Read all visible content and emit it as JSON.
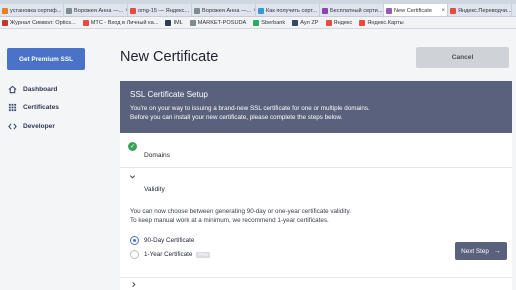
{
  "browser": {
    "tabs": [
      {
        "label": "установка сертиф...",
        "color": "#e67e22"
      },
      {
        "label": "Ворожея Анна —...",
        "color": "#7f8c8d"
      },
      {
        "label": "omg-15 — Яндекс...",
        "color": "#e74c3c"
      },
      {
        "label": "Ворожея Анна —...",
        "color": "#7f8c8d"
      },
      {
        "label": "Как получить серт...",
        "color": "#3498db"
      },
      {
        "label": "Бесплатный серти...",
        "color": "#8e44ad"
      },
      {
        "label": "New Certificate",
        "color": "#9b59b6",
        "active": true
      },
      {
        "label": "Яндекс.Переводчи...",
        "color": "#e74c3c"
      }
    ],
    "bookmarks": [
      {
        "label": "Журнал Символ: Optics...",
        "color": "#c0392b"
      },
      {
        "label": "МТС - Вход в Личный ка...",
        "color": "#e74c3c"
      },
      {
        "label": "IML",
        "color": "#2c3e50"
      },
      {
        "label": "MARKET-POSUDA",
        "color": "#7f8c8d"
      },
      {
        "label": "Sberbank",
        "color": "#27ae60"
      },
      {
        "label": "Аул ZP",
        "color": "#34495e"
      },
      {
        "label": "Яндекс",
        "color": "#e74c3c"
      },
      {
        "label": "Яндекс.Карты",
        "color": "#e74c3c"
      }
    ]
  },
  "sidebar": {
    "premium_button": "Get Premium SSL",
    "items": [
      {
        "label": "Dashboard",
        "icon": "home-icon"
      },
      {
        "label": "Certificates",
        "icon": "grid-icon"
      },
      {
        "label": "Developer",
        "icon": "code-icon"
      }
    ]
  },
  "header": {
    "title": "New Certificate",
    "cancel_label": "Cancel"
  },
  "setup": {
    "title": "SSL Certificate Setup",
    "subtitle_line1": "You're on your way to issuing a brand-new SSL certificate for one or multiple domains.",
    "subtitle_line2": "Before you can install your new certificate, please complete the steps below."
  },
  "steps": {
    "domains_label": "Domains",
    "validity_label": "Validity",
    "validity_desc1": "You can now choose between generating 90-day or one-year certificate validity.",
    "validity_desc2": "To keep manual work at a minimum, we recommend 1-year certificates.",
    "options": [
      {
        "label": "90-Day Certificate",
        "selected": true
      },
      {
        "label": "1-Year Certificate",
        "selected": false,
        "badge": "PRO"
      }
    ],
    "next_label": "Next Step"
  },
  "colors": {
    "accent": "#4a72c9",
    "header_bg": "#59617c",
    "success": "#3aa35a"
  }
}
